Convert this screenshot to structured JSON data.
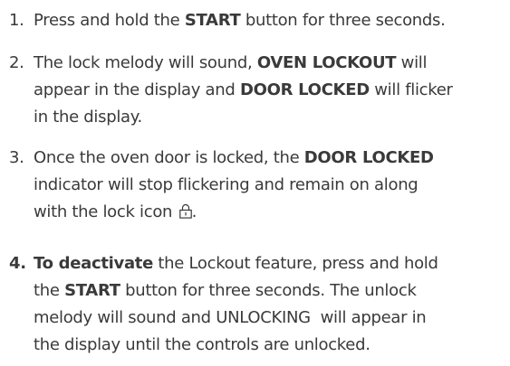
{
  "steps": [
    {
      "number": "1.",
      "parts": [
        "Press and hold the ",
        "START",
        " button for three seconds."
      ]
    },
    {
      "number": "2.",
      "lines": [
        [
          "The lock melody will sound, ",
          "OVEN LOCKOUT",
          " will"
        ],
        [
          "appear in the display and ",
          "DOOR LOCKED",
          " will flicker"
        ],
        [
          "in the display."
        ]
      ]
    },
    {
      "number": "3.",
      "lines": [
        [
          "Once the oven door is locked, the ",
          "DOOR LOCKED"
        ],
        [
          "indicator will stop flickering and remain on along"
        ],
        [
          "with the lock icon ",
          "."
        ]
      ],
      "icon": "lock-icon"
    },
    {
      "number": "4.",
      "lines": [
        [
          "To deactivate",
          " the Lockout feature, press and hold"
        ],
        [
          "the ",
          "START",
          " button for three seconds. The unlock"
        ],
        [
          "melody will sound and UNLOCKING  will appear in"
        ],
        [
          "the display until the controls are unlocked."
        ]
      ]
    }
  ]
}
